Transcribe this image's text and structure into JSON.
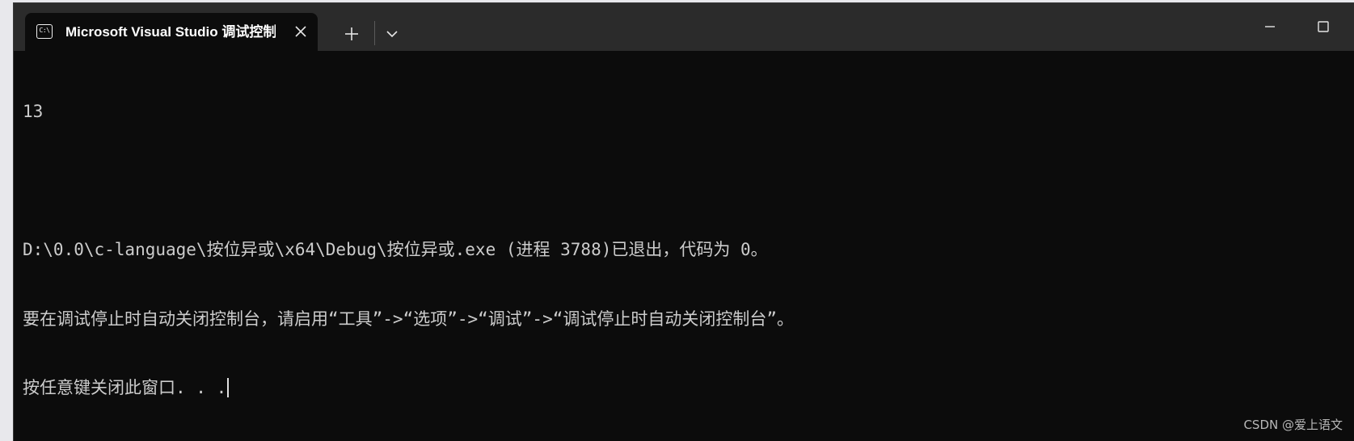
{
  "window": {
    "tab_title": "Microsoft Visual Studio 调试控制台",
    "tab_icon": "console-icon",
    "tab_icon_glyph": "C:\\",
    "new_tab_glyph": "+",
    "colors": {
      "titlebar": "#2b2b2b",
      "console_background": "#0c0c0c",
      "console_text": "#cccccc"
    }
  },
  "console": {
    "lines": [
      "13",
      "",
      "D:\\0.0\\c-language\\按位异或\\x64\\Debug\\按位异或.exe (进程 3788)已退出，代码为 0。",
      "要在调试停止时自动关闭控制台，请启用“工具”->“选项”->“调试”->“调试停止时自动关闭控制台”。",
      "按任意键关闭此窗口. . ."
    ]
  },
  "watermark": "CSDN @爱上语文"
}
